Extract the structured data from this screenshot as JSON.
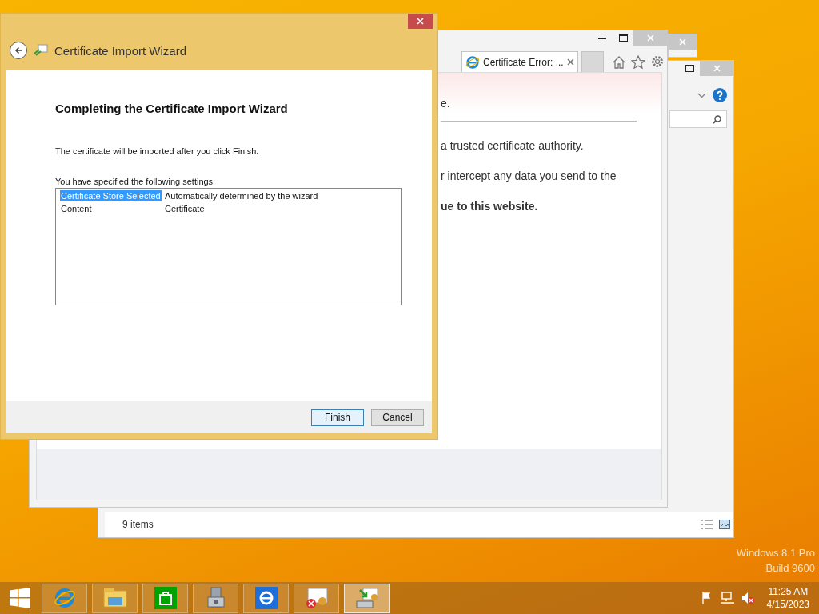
{
  "wizard": {
    "title": "Certificate Import Wizard",
    "heading": "Completing the Certificate Import Wizard",
    "message": "The certificate will be imported after you click Finish.",
    "settings_label": "You have specified the following settings:",
    "settings": [
      {
        "name": "Certificate Store Selected",
        "value": "Automatically determined by the wizard",
        "selected": true
      },
      {
        "name": "Content",
        "value": "Certificate",
        "selected": false
      }
    ],
    "buttons": [
      {
        "label": "Finish",
        "focused": true
      },
      {
        "label": "Cancel",
        "focused": false
      }
    ]
  },
  "browser": {
    "tab": "Certificate Error: ...",
    "lines": [
      {
        "text": "e.",
        "bold": false
      },
      {
        "text": "a trusted certificate authority.",
        "bold": false
      },
      {
        "text": "r intercept any data you send to the",
        "bold": false
      },
      {
        "text": "ue to this website.",
        "bold": true
      }
    ]
  },
  "explorer": {
    "status": "9 items"
  },
  "os_edition": [
    "Windows 8.1 Pro",
    "Build 9600"
  ],
  "taskbar": {
    "apps": [
      {
        "kind": "ie",
        "active": false
      },
      {
        "kind": "folder",
        "active": false
      },
      {
        "kind": "store",
        "active": false
      },
      {
        "kind": "tools",
        "active": false
      },
      {
        "kind": "ie-tile",
        "active": false
      },
      {
        "kind": "cert-error",
        "active": false
      },
      {
        "kind": "cert-import",
        "active": true
      }
    ],
    "time": "11:25 AM",
    "date": "4/15/2023"
  }
}
